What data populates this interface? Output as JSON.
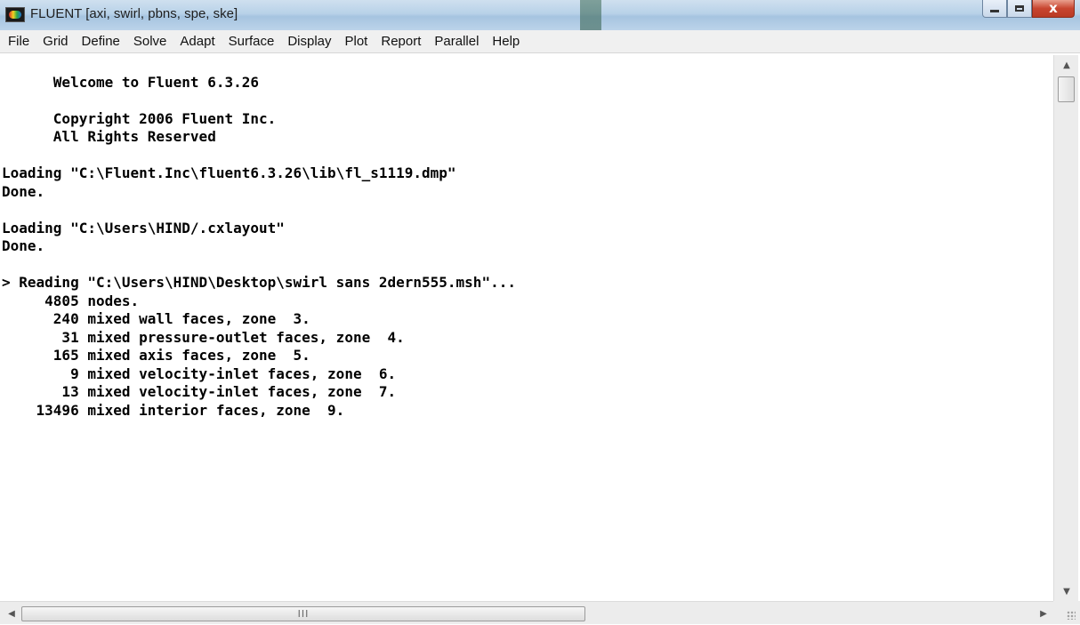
{
  "window": {
    "title": "FLUENT  [axi, swirl, pbns, spe, ske]",
    "controls": {
      "minimize": "",
      "maximize": "",
      "close": "x"
    }
  },
  "menu": [
    "File",
    "Grid",
    "Define",
    "Solve",
    "Adapt",
    "Surface",
    "Display",
    "Plot",
    "Report",
    "Parallel",
    "Help"
  ],
  "console": {
    "lines": [
      "",
      "      Welcome to Fluent 6.3.26",
      "",
      "      Copyright 2006 Fluent Inc.",
      "      All Rights Reserved",
      "",
      "Loading \"C:\\Fluent.Inc\\fluent6.3.26\\lib\\fl_s1119.dmp\"",
      "Done.",
      "",
      "Loading \"C:\\Users\\HIND/.cxlayout\"",
      "Done.",
      "",
      "> Reading \"C:\\Users\\HIND\\Desktop\\swirl sans 2dern555.msh\"...",
      "     4805 nodes.",
      "      240 mixed wall faces, zone  3.",
      "       31 mixed pressure-outlet faces, zone  4.",
      "      165 mixed axis faces, zone  5.",
      "        9 mixed velocity-inlet faces, zone  6.",
      "       13 mixed velocity-inlet faces, zone  7.",
      "    13496 mixed interior faces, zone  9."
    ]
  },
  "scrollbars": {
    "horizontal_grip": "III"
  }
}
